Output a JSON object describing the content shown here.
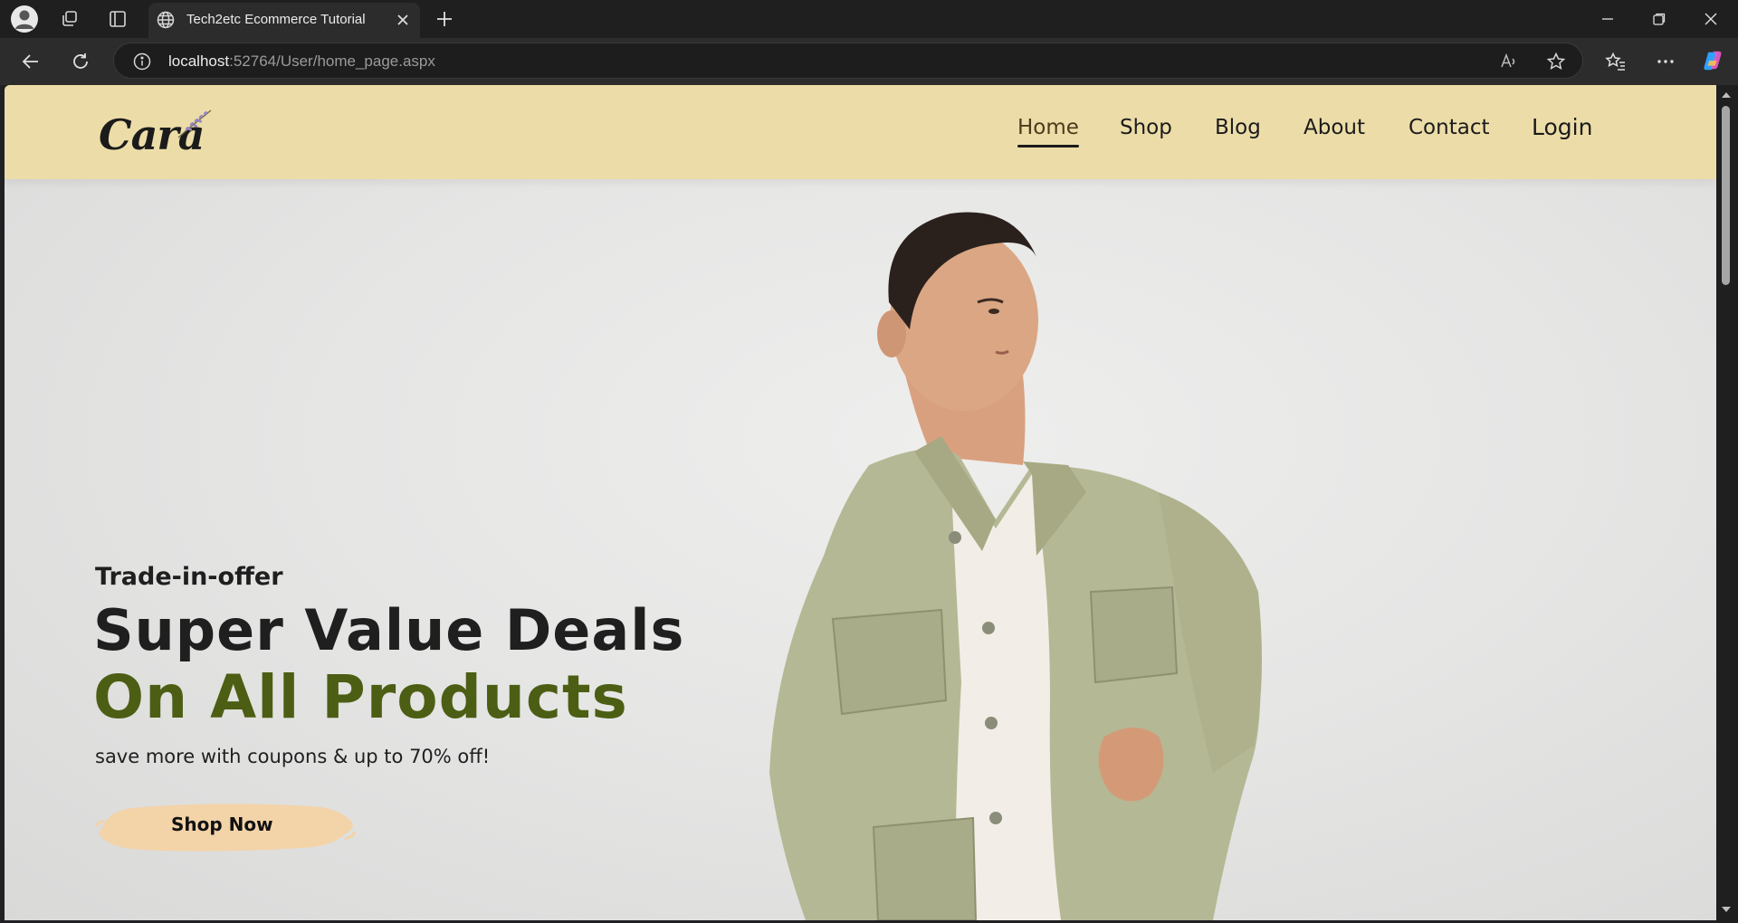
{
  "browser": {
    "tab_title": "Tech2etc Ecommerce Tutorial",
    "address_host": "localhost",
    "address_rest": ":52764/User/home_page.aspx"
  },
  "site": {
    "logo_text": "Cara",
    "nav": [
      "Home",
      "Shop",
      "Blog",
      "About",
      "Contact",
      "Login"
    ],
    "active_nav": "Home"
  },
  "hero": {
    "eyebrow": "Trade-in-offer",
    "headline": "Super Value Deals",
    "headline_accent": "On All Products",
    "subtitle": "save more with coupons & up to 70% off!",
    "cta_label": "Shop Now"
  },
  "colors": {
    "header_bg": "#ecdda8",
    "accent_green": "#4c5e13",
    "cta_brush": "#f3d3a8"
  }
}
